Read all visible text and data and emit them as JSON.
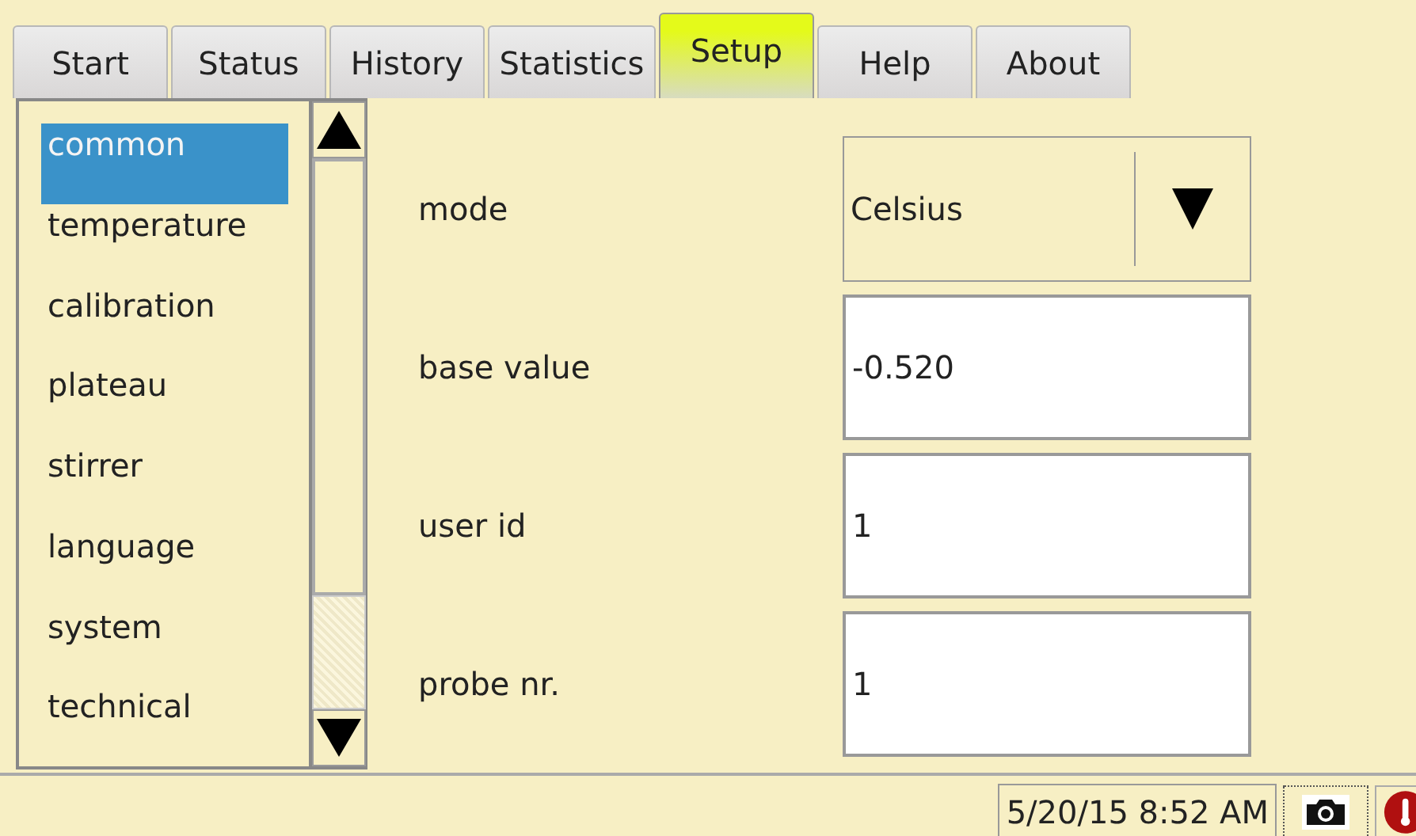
{
  "tabs": [
    {
      "label": "Start",
      "selected": false
    },
    {
      "label": "Status",
      "selected": false
    },
    {
      "label": "History",
      "selected": false
    },
    {
      "label": "Statistics",
      "selected": false
    },
    {
      "label": "Setup",
      "selected": true
    },
    {
      "label": "Help",
      "selected": false
    },
    {
      "label": "About",
      "selected": false
    }
  ],
  "sidebar": {
    "items": [
      {
        "label": "common",
        "selected": true
      },
      {
        "label": "temperature",
        "selected": false
      },
      {
        "label": "calibration",
        "selected": false
      },
      {
        "label": "plateau",
        "selected": false
      },
      {
        "label": "stirrer",
        "selected": false
      },
      {
        "label": "language",
        "selected": false
      },
      {
        "label": "system",
        "selected": false
      },
      {
        "label": "technical",
        "selected": false
      }
    ]
  },
  "fields": [
    {
      "kind": "dropdown",
      "label": "mode",
      "value": "Celsius"
    },
    {
      "kind": "text",
      "label": "base value",
      "value": "-0.520"
    },
    {
      "kind": "text",
      "label": "user id",
      "value": "1"
    },
    {
      "kind": "text",
      "label": "probe nr.",
      "value": "1"
    }
  ],
  "status_bar": {
    "datetime": "5/20/15 8:52 AM"
  }
}
